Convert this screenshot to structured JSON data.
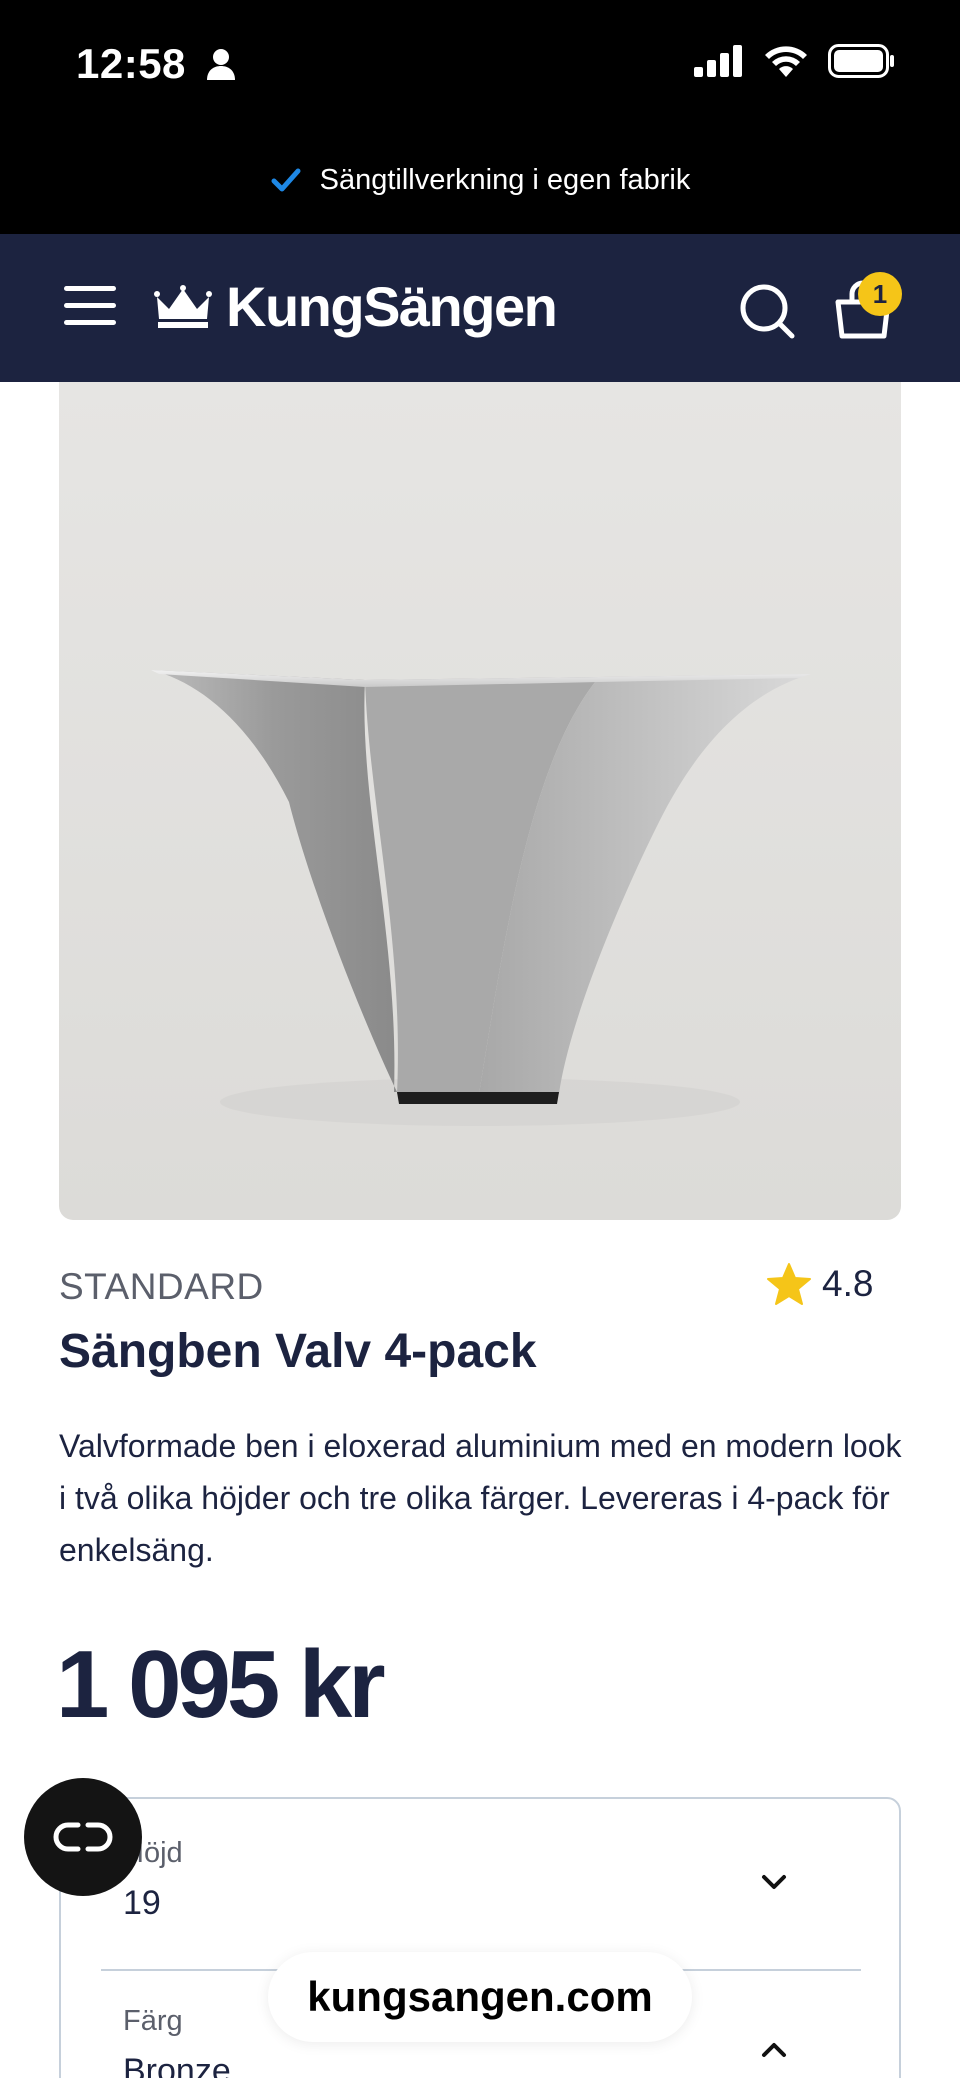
{
  "status_bar": {
    "time": "12:58"
  },
  "announcement": {
    "text": "Sängtillverkning i egen fabrik"
  },
  "header": {
    "logo_text": "KungSängen",
    "cart_count": "1"
  },
  "product": {
    "brand": "STANDARD",
    "rating": "4.8",
    "title": "Sängben Valv 4-pack",
    "description": "Valvformade ben i eloxerad aluminium med en modern look i två olika höjder och tre olika färger. Levereras i 4-pack för enkelsäng.",
    "price": "1 095 kr"
  },
  "options": [
    {
      "label": "Höjd",
      "value": "19"
    },
    {
      "label": "Färg",
      "value": "Bronze"
    }
  ],
  "browser": {
    "url": "kungsangen.com"
  },
  "colors": {
    "navy": "#1c2340",
    "badge": "#f5c518",
    "check": "#1e88e5",
    "star": "#f5c518"
  },
  "icons": [
    "person-icon",
    "signal-icon",
    "wifi-icon",
    "battery-icon",
    "check-icon",
    "menu-icon",
    "crown-icon",
    "search-icon",
    "cart-icon",
    "star-icon",
    "chevron-down-icon",
    "chevron-up-icon",
    "link-icon"
  ]
}
